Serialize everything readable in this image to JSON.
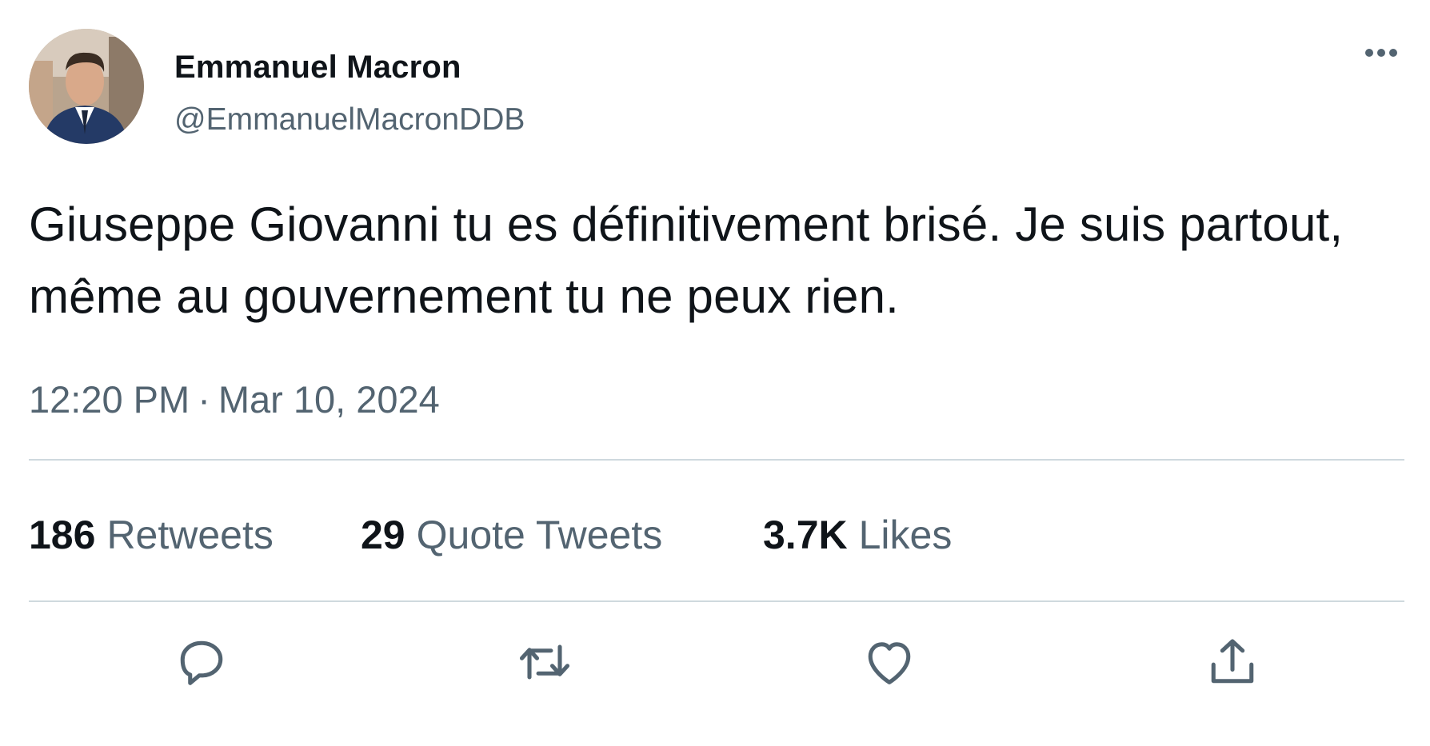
{
  "author": {
    "name": "Emmanuel Macron",
    "handle": "@EmmanuelMacronDDB"
  },
  "tweet": {
    "text": "Giuseppe Giovanni tu es définitivement brisé. Je suis partout, même au gouvernement tu ne peux rien.",
    "time": "12:20 PM",
    "separator": "·",
    "date": "Mar 10, 2024"
  },
  "stats": {
    "retweets": {
      "count": "186",
      "label": "Retweets"
    },
    "quote_tweets": {
      "count": "29",
      "label": "Quote Tweets"
    },
    "likes": {
      "count": "3.7K",
      "label": "Likes"
    }
  },
  "actions": {
    "reply_icon": "reply-icon",
    "retweet_icon": "retweet-icon",
    "like_icon": "heart-icon",
    "share_icon": "share-icon",
    "more_icon": "more-horizontal-icon"
  },
  "colors": {
    "text_primary": "#0f1419",
    "text_secondary": "#536471",
    "divider": "#cfd9de",
    "icon": "#536471"
  }
}
